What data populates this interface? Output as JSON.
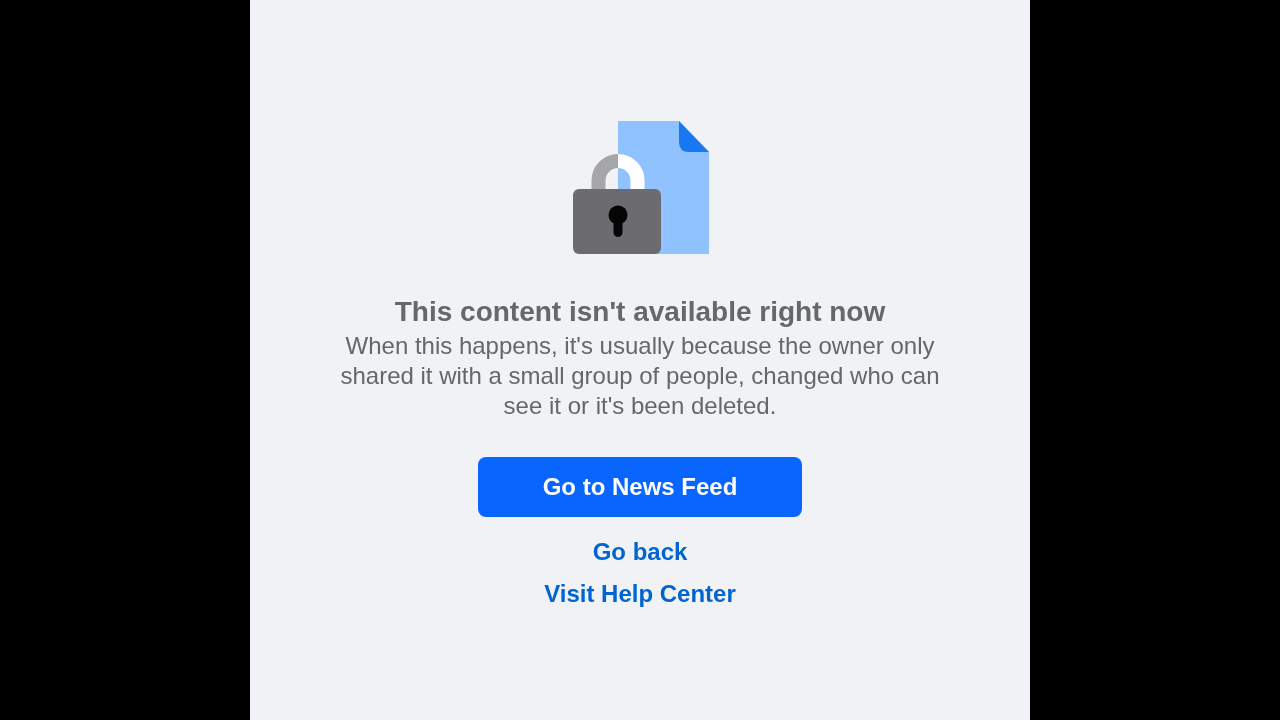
{
  "heading": "This content isn't available right now",
  "message": "When this happens, it's usually because the owner only shared it with a small group of people, changed who can see it or it's been deleted.",
  "primary_button": "Go to News Feed",
  "links": [
    "Go back",
    "Visit Help Center"
  ]
}
